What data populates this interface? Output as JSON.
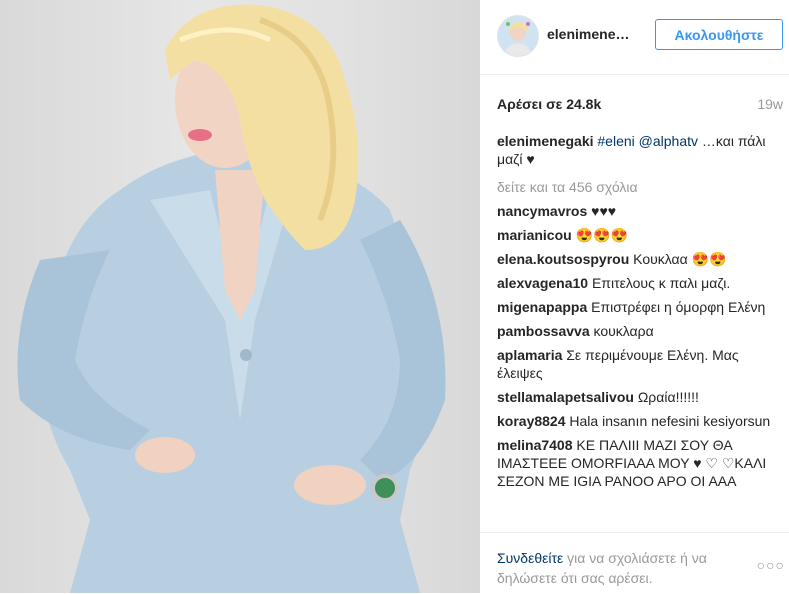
{
  "post": {
    "username": "elenimene…",
    "follow_label": "Ακολουθήστε",
    "likes": "Αρέσει σε 24.8k",
    "time": "19w",
    "caption": {
      "user": "elenimenegaki",
      "tags": [
        "#eleni",
        "@alphatv"
      ],
      "text": " …και πάλι μαζί ♥"
    },
    "view_all": "δείτε και τα 456 σχόλια",
    "comments": [
      {
        "user": "nancymavros",
        "text": " ♥♥♥"
      },
      {
        "user": "marianicou",
        "text": " 😍😍😍"
      },
      {
        "user": "elena.koutsospyrou",
        "text": " Κουκλαα 😍😍"
      },
      {
        "user": "alexvagena10",
        "text": " Επιτελους κ παλι μαζι."
      },
      {
        "user": "migenapappa",
        "text": " Επιστρέφει η όμορφη Ελένη"
      },
      {
        "user": "pambossavva",
        "text": " κουκλαρα"
      },
      {
        "user": "aplamaria",
        "text": " Σε περιμένουμε Ελένη. Μας έλειψες"
      },
      {
        "user": "stellamalapetsalivou",
        "text": " Ωραία!!!!!!"
      },
      {
        "user": "koray8824",
        "text": " Hala insanın nefesini kesiyorsun"
      },
      {
        "user": "melina7408",
        "text": " ΚΕ ΠΑΛΙΙΙ ΜΑΖΙ ΣΟΥ ΘΑ ΙΜΑΣΤΕΕΕ ΟΜΟRFΙΑΑΑ ΜΟΥ ♥ ♡ ♡ΚΑΛΙ ΣΕΖΟΝ ΜΕ ΙGΙΑ ΡΑΝΟΟ ΑΡΟ ΟΙ ΑΑΑ"
      }
    ],
    "login_link": "Συνδεθείτε",
    "login_text": " για να σχολιάσετε ή να δηλώσετε ότι σας αρέσει.",
    "more_dots": "○○○"
  }
}
